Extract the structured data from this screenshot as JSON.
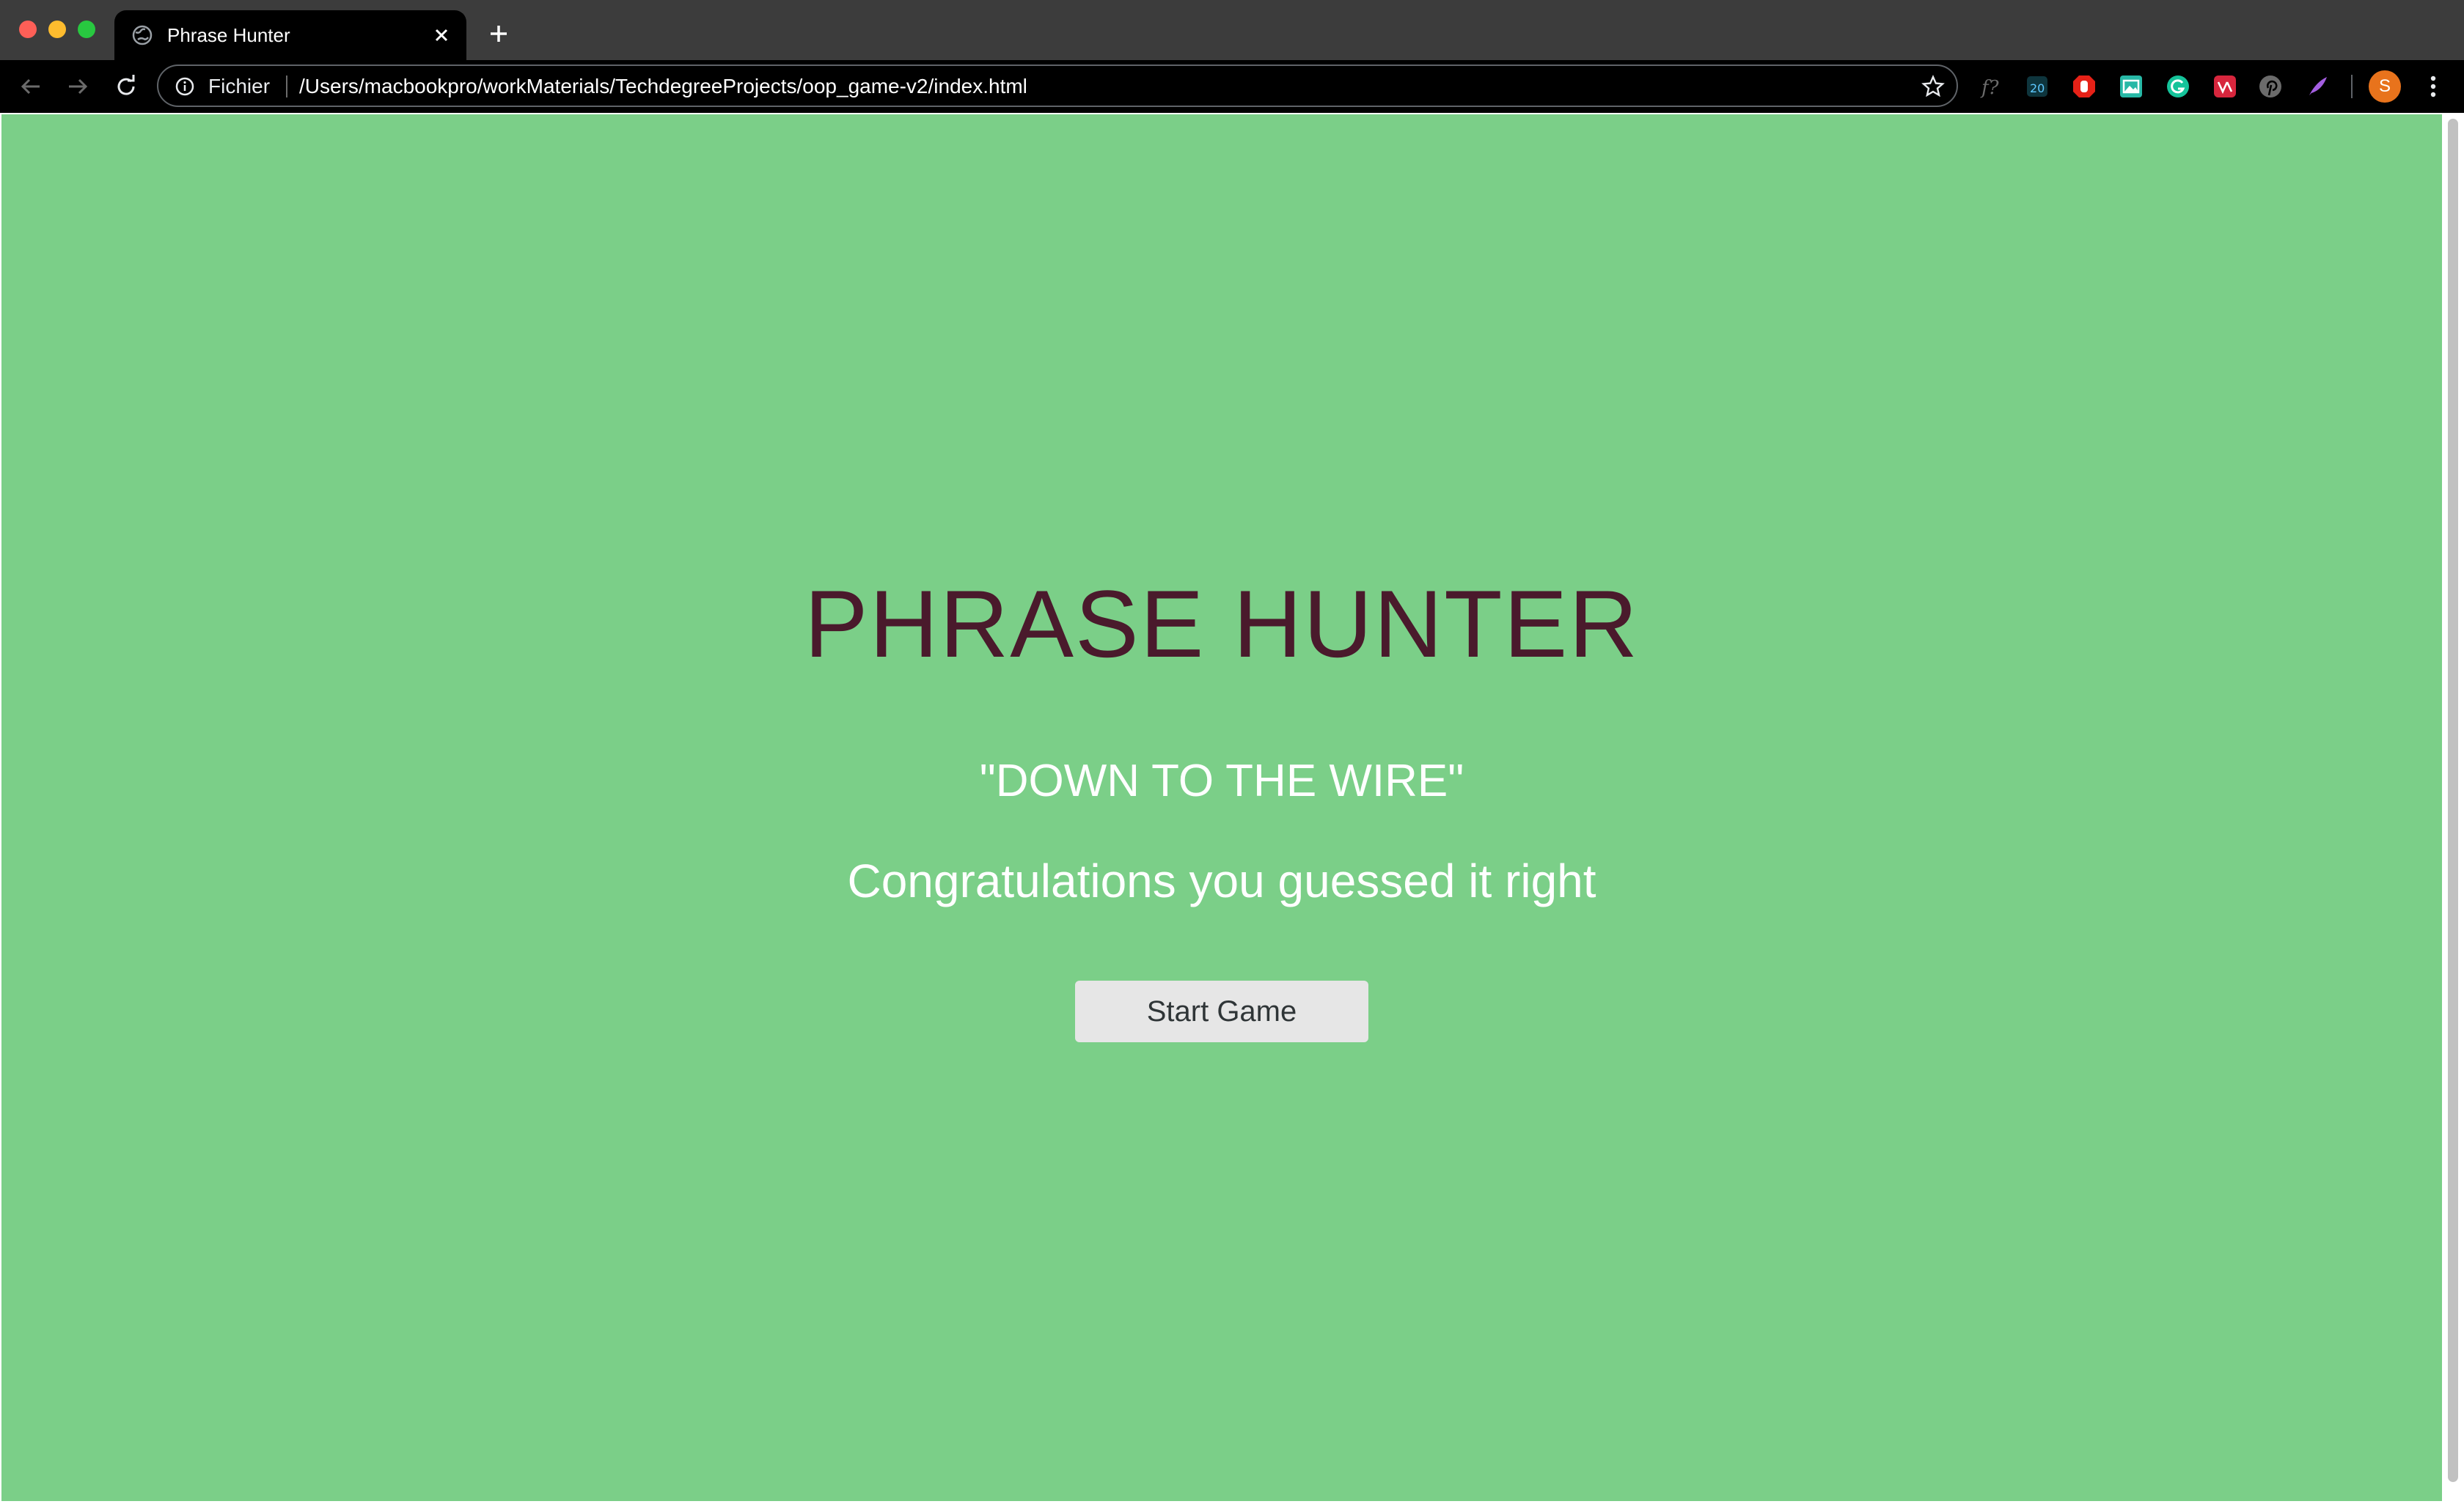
{
  "browser": {
    "tab_title": "Phrase Hunter",
    "scheme_label": "Fichier",
    "url": "/Users/macbookpro/workMaterials/TechdegreeProjects/oop_game-v2/index.html",
    "profile_initial": "S",
    "extensions": [
      "formula-icon",
      "dashlane-icon",
      "adblock-icon",
      "image-extension-icon",
      "grammarly-icon",
      "vivaldi-extension-icon",
      "pinterest-icon",
      "quill-icon"
    ]
  },
  "game": {
    "title": "PHRASE HUNTER",
    "phrase": "\"DOWN TO THE WIRE\"",
    "message": "Congratulations you guessed it right",
    "start_button": "Start Game"
  },
  "colors": {
    "background": "#7bcf88",
    "title": "#4a1a2c",
    "text": "#ffffff",
    "button_bg": "#e6e6e6"
  }
}
